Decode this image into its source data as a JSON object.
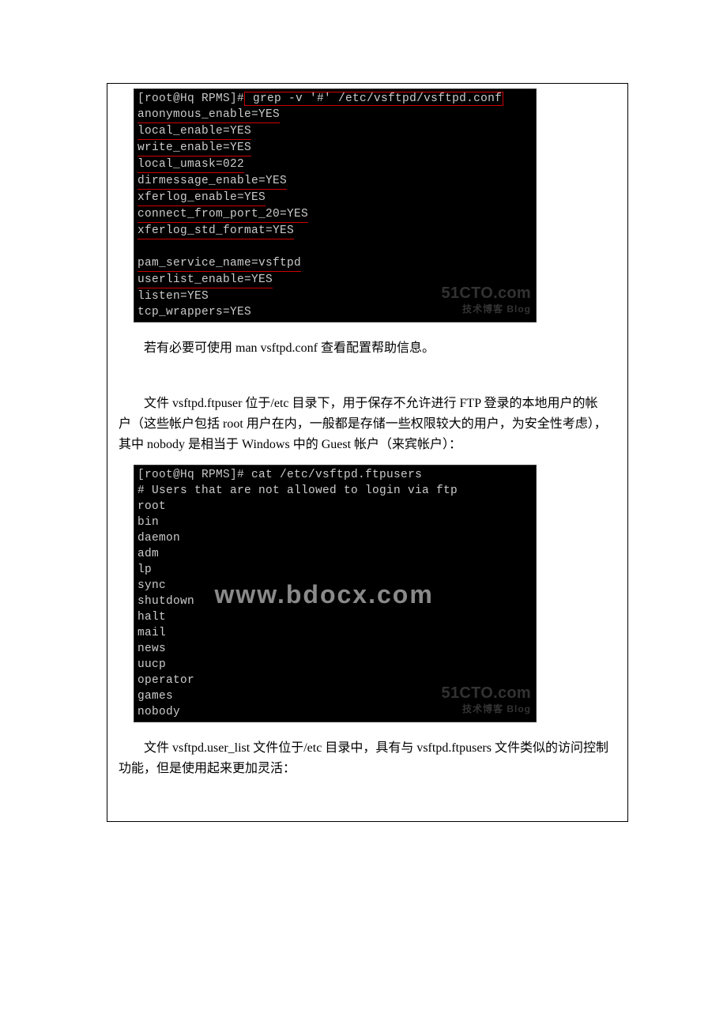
{
  "terminal1": {
    "prompt": "[root@Hq RPMS]#",
    "command": " grep -v '#' /etc/vsftpd/vsftpd.conf",
    "lines": [
      "anonymous_enable=YES",
      "local_enable=YES",
      "write_enable=YES",
      "local_umask=022",
      "dirmessage_enable=YES",
      "xferlog_enable=YES",
      "connect_from_port_20=YES",
      "xferlog_std_format=YES",
      "",
      "pam_service_name=vsftpd",
      "userlist_enable=YES",
      "listen=YES",
      "tcp_wrappers=YES"
    ],
    "watermark": "51CTO.com",
    "watermark_sub": "技术博客  Blog"
  },
  "para1": "若有必要可使用 man vsftpd.conf 查看配置帮助信息。",
  "para2": "文件 vsftpd.ftpuser 位于/etc 目录下，用于保存不允许进行 FTP 登录的本地用户的帐户（这些帐户包括 root 用户在内，一般都是存储一些权限较大的用户，为安全性考虑），其中 nobody 是相当于 Windows 中的 Guest 帐户（来宾帐户）：",
  "terminal2": {
    "prompt": "[root@Hq RPMS]#",
    "command": " cat /etc/vsftpd.ftpusers",
    "lines": [
      "# Users that are not allowed to login via ftp",
      "root",
      "bin",
      "daemon",
      "adm",
      "lp",
      "sync",
      "shutdown",
      "halt",
      "mail",
      "news",
      "uucp",
      "operator",
      "games",
      "nobody"
    ],
    "watermark": "51CTO.com",
    "watermark_sub": "技术博客  Blog"
  },
  "para3": "文件 vsftpd.user_list 文件位于/etc 目录中，具有与 vsftpd.ftpusers 文件类似的访问控制功能，但是使用起来更加灵活：",
  "bdocx_watermark": "www.bdocx.com"
}
